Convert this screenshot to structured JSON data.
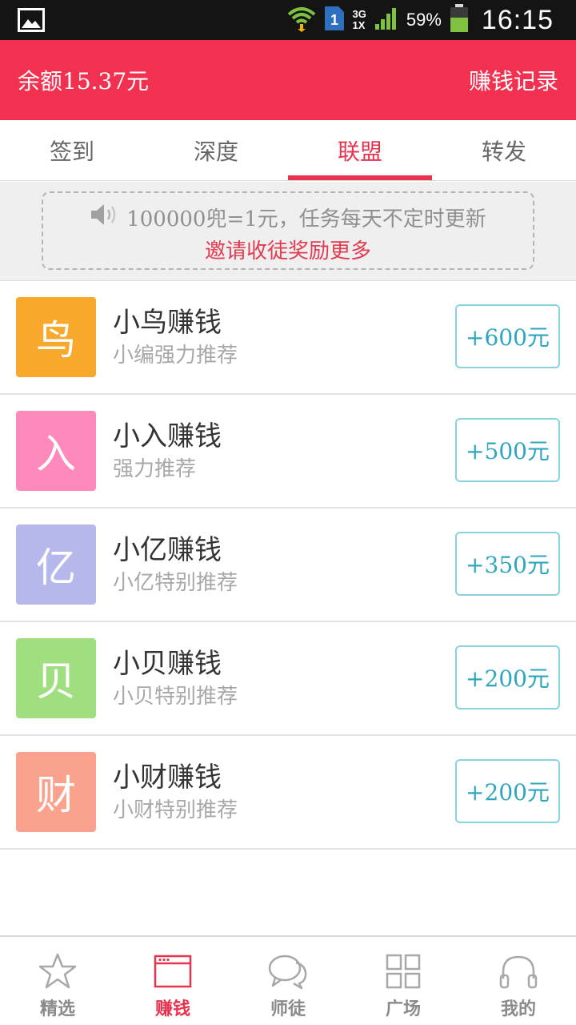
{
  "status_bar": {
    "network_top": "3G",
    "network_bottom": "1X",
    "sim_slot": "1",
    "battery": "59%",
    "time": "16:15"
  },
  "header": {
    "balance": "余额15.37元",
    "record": "赚钱记录"
  },
  "tabs": [
    {
      "label": "签到",
      "active": false
    },
    {
      "label": "深度",
      "active": false
    },
    {
      "label": "联盟",
      "active": true
    },
    {
      "label": "转发",
      "active": false
    }
  ],
  "notice": {
    "line1": "100000兜=1元，任务每天不定时更新",
    "line2": "邀请收徒奖励更多"
  },
  "list": [
    {
      "logo_char": "鸟",
      "logo_color": "#f8a82b",
      "title": "小鸟赚钱",
      "subtitle": "小编强力推荐",
      "reward": "+600元"
    },
    {
      "logo_char": "入",
      "logo_color": "#fd8abb",
      "title": "小入赚钱",
      "subtitle": "强力推荐",
      "reward": "+500元"
    },
    {
      "logo_char": "亿",
      "logo_color": "#b6b8ec",
      "title": "小亿赚钱",
      "subtitle": "小亿特别推荐",
      "reward": "+350元"
    },
    {
      "logo_char": "贝",
      "logo_color": "#a0df80",
      "title": "小贝赚钱",
      "subtitle": "小贝特别推荐",
      "reward": "+200元"
    },
    {
      "logo_char": "财",
      "logo_color": "#fba28e",
      "title": "小财赚钱",
      "subtitle": "小财特别推荐",
      "reward": "+200元"
    }
  ],
  "bottom_nav": [
    {
      "label": "精选",
      "icon": "star-icon",
      "active": false
    },
    {
      "label": "赚钱",
      "icon": "browser-window-icon",
      "active": true
    },
    {
      "label": "师徒",
      "icon": "chat-bubbles-icon",
      "active": false
    },
    {
      "label": "广场",
      "icon": "grid-icon",
      "active": false
    },
    {
      "label": "我的",
      "icon": "headphones-icon",
      "active": false
    }
  ],
  "colors": {
    "primary": "#f2304f",
    "tab_active": "#e8334f",
    "reward_border": "#87d4dc",
    "reward_text": "#2ea6bd"
  }
}
